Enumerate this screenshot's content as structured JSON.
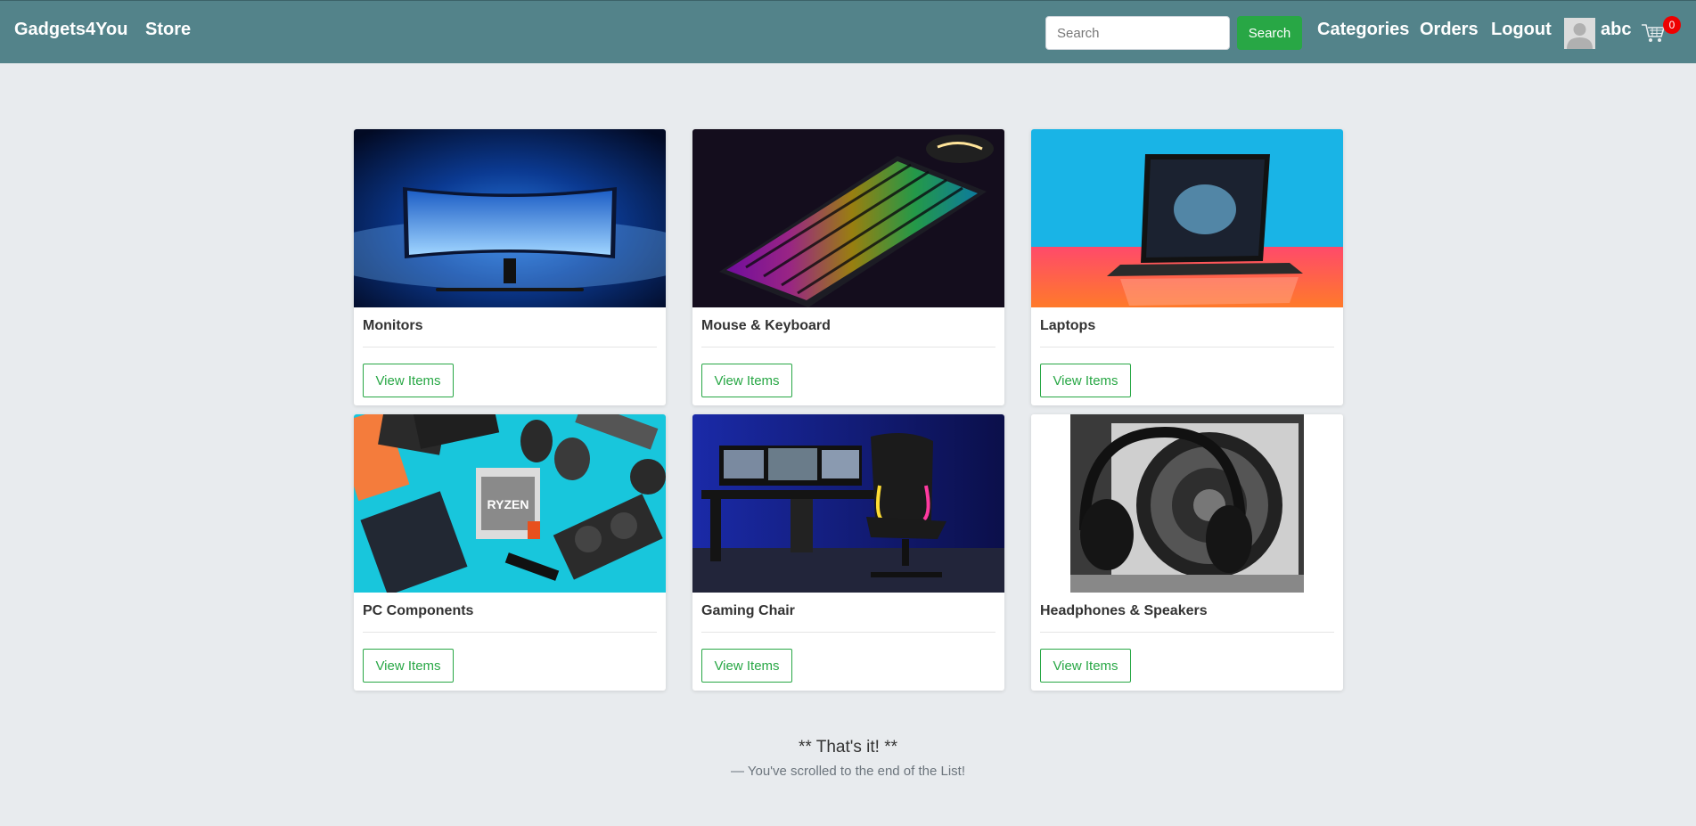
{
  "navbar": {
    "brand": "Gadgets4You",
    "store": "Store",
    "search_placeholder": "Search",
    "search_button": "Search",
    "categories": "Categories",
    "orders": "Orders",
    "logout": "Logout",
    "user_name": "abc",
    "cart_count": "0",
    "colors": {
      "background": "#53838a",
      "search_button": "#28a745",
      "badge": "#ee0000"
    }
  },
  "categories": [
    {
      "title": "Monitors",
      "button": "View Items",
      "image": "monitor-image"
    },
    {
      "title": "Mouse & Keyboard",
      "button": "View Items",
      "image": "keyboard-image"
    },
    {
      "title": "Laptops",
      "button": "View Items",
      "image": "laptop-image"
    },
    {
      "title": "PC Components",
      "button": "View Items",
      "image": "pc-components-image"
    },
    {
      "title": "Gaming Chair",
      "button": "View Items",
      "image": "gaming-chair-image"
    },
    {
      "title": "Headphones & Speakers",
      "button": "View Items",
      "image": "headphones-speakers-image"
    }
  ],
  "footer": {
    "title": "** That's it! **",
    "subtitle": "—  You've scrolled to the end of the List!"
  }
}
